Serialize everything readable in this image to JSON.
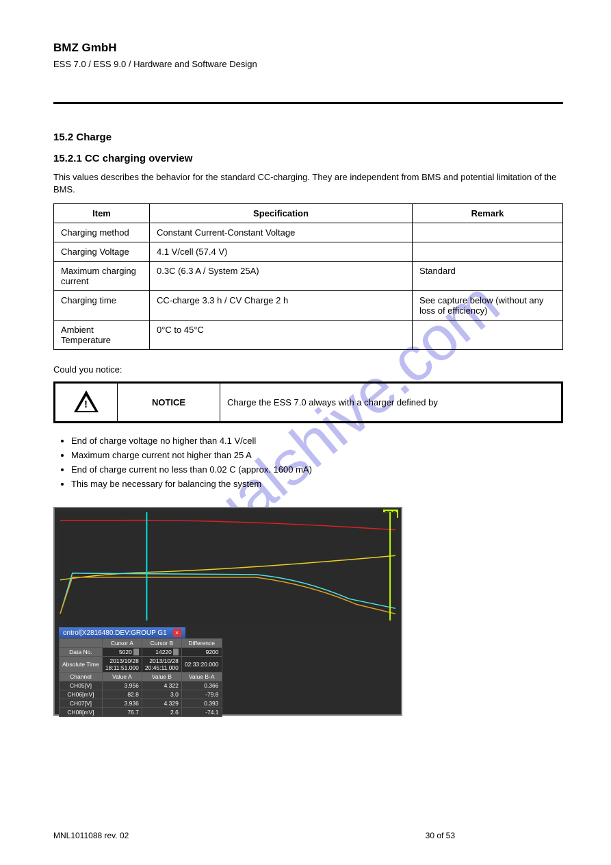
{
  "header": {
    "brand": "BMZ GmbH",
    "docline": "ESS 7.0 / ESS 9.0 / Hardware and Software Design"
  },
  "section": {
    "num_title": "15.2 Charge",
    "sub": "15.2.1 CC charging overview",
    "intro": "This values describes the behavior for the standard CC-charging. They are independent from BMS and potential limitation of the BMS."
  },
  "table1": {
    "headers": {
      "item": "Item",
      "spec": "Specification",
      "remark": "Remark"
    },
    "rows": [
      {
        "item": "Charging method",
        "spec": "Constant Current-Constant Voltage",
        "remark": ""
      },
      {
        "item": "Charging Voltage",
        "spec": "4.1 V/cell (57.4 V)",
        "remark": ""
      },
      {
        "item": "Maximum charging current",
        "spec": "0.3C (6.3 A / System 25A)",
        "remark": "Standard"
      },
      {
        "item": "Charging time",
        "spec": "CC-charge 3.3 h / CV Charge 2 h",
        "remark": "See capture below (without any loss of efficiency)"
      },
      {
        "item": "Ambient Temperature",
        "spec": "0°C to 45°C",
        "remark": ""
      }
    ]
  },
  "notice_title": "Could you notice:",
  "notice": {
    "label": "NOTICE",
    "text": "Charge the ESS 7.0 always with a charger defined by"
  },
  "bullets": [
    "End of charge voltage no higher than 4.1 V/cell",
    "Maximum charge current not higher than 25 A",
    "End of charge current no less than 0.02 C (approx. 1600 mA)",
    "This may be necessary for balancing the system"
  ],
  "chart_data": {
    "type": "line",
    "title": "ontrol[X2816480.DEV:GROUP G1",
    "trg": "TRG",
    "series": [
      {
        "name": "CH05[V]",
        "color": "red"
      },
      {
        "name": "CH06[mV]",
        "color": "cyan"
      },
      {
        "name": "CH07[V]",
        "color": "yellow"
      },
      {
        "name": "CH08[mV]",
        "color": "orange"
      }
    ],
    "x_range": [
      0,
      20000
    ],
    "cursorA_x": 5020,
    "cursorB_x": 14220,
    "table": {
      "headers": [
        "",
        "Cursor A",
        "Cursor B",
        "Difference"
      ],
      "rows": [
        {
          "label": "Data No.",
          "a": "5020",
          "b": "14220",
          "diff": "9200",
          "spin": true
        },
        {
          "label": "Absolute Time",
          "a": "2013/10/28\n18:11:51.000",
          "b": "2013/10/28\n20:45:11.000",
          "diff": "02:33:20.000"
        }
      ],
      "ch_header": [
        "Channel",
        "Value A",
        "Value B",
        "Value B-A"
      ],
      "ch_rows": [
        {
          "label": "CH05[V]",
          "a": "3.956",
          "b": "4.322",
          "diff": "0.366"
        },
        {
          "label": "CH06[mV]",
          "a": "82.8",
          "b": "3.0",
          "diff": "-79.8"
        },
        {
          "label": "CH07[V]",
          "a": "3.936",
          "b": "4.329",
          "diff": "0.393"
        },
        {
          "label": "CH08[mV]",
          "a": "76.7",
          "b": "2.6",
          "diff": "-74.1"
        }
      ]
    }
  },
  "footer": {
    "rev": "MNL1011088 rev. 02",
    "page": "30 of 53"
  },
  "watermark": "manualshive.com"
}
